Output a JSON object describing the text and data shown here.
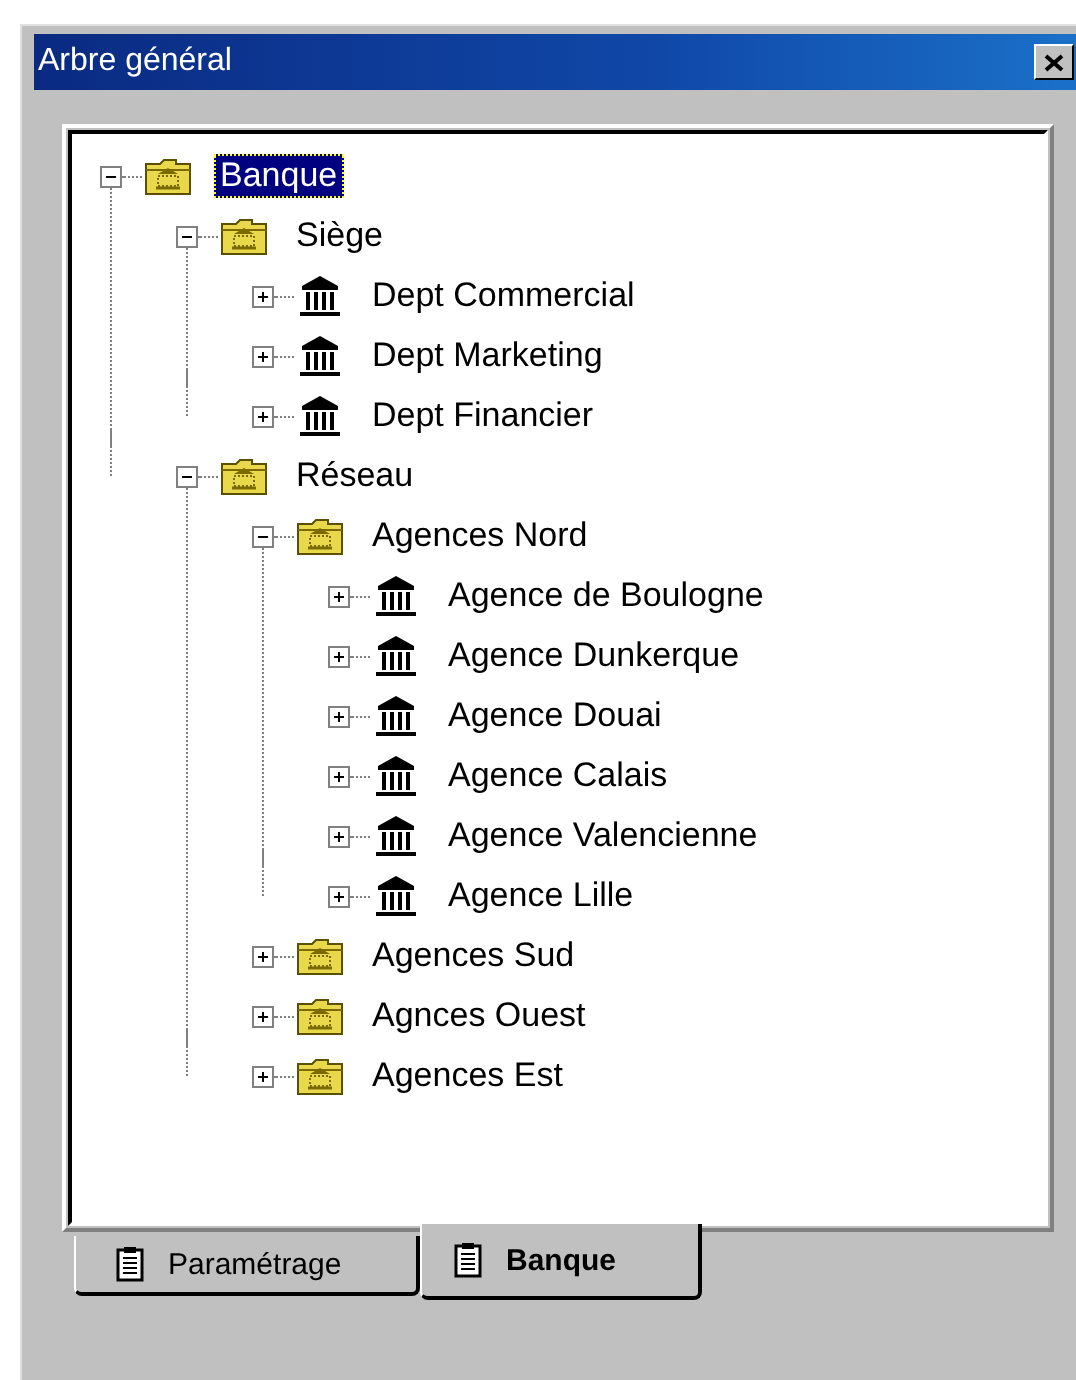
{
  "window": {
    "title": "Arbre général"
  },
  "tree": [
    {
      "label": "Banque",
      "kind": "folder",
      "expanded": true,
      "selected": true,
      "children": [
        {
          "label": "Siège",
          "kind": "folder",
          "expanded": true,
          "selected": false,
          "children": [
            {
              "label": "Dept Commercial",
              "kind": "bank",
              "expanded": false,
              "selected": false
            },
            {
              "label": "Dept Marketing",
              "kind": "bank",
              "expanded": false,
              "selected": false
            },
            {
              "label": "Dept Financier",
              "kind": "bank",
              "expanded": false,
              "selected": false
            }
          ]
        },
        {
          "label": "Réseau",
          "kind": "folder",
          "expanded": true,
          "selected": false,
          "children": [
            {
              "label": "Agences Nord",
              "kind": "folder",
              "expanded": true,
              "selected": false,
              "children": [
                {
                  "label": "Agence de Boulogne",
                  "kind": "bank",
                  "expanded": false,
                  "selected": false
                },
                {
                  "label": "Agence Dunkerque",
                  "kind": "bank",
                  "expanded": false,
                  "selected": false
                },
                {
                  "label": "Agence Douai",
                  "kind": "bank",
                  "expanded": false,
                  "selected": false
                },
                {
                  "label": "Agence Calais",
                  "kind": "bank",
                  "expanded": false,
                  "selected": false
                },
                {
                  "label": "Agence Valencienne",
                  "kind": "bank",
                  "expanded": false,
                  "selected": false
                },
                {
                  "label": "Agence Lille",
                  "kind": "bank",
                  "expanded": false,
                  "selected": false
                }
              ]
            },
            {
              "label": "Agences Sud",
              "kind": "folder",
              "expanded": false,
              "selected": false
            },
            {
              "label": "Agnces Ouest",
              "kind": "folder",
              "expanded": false,
              "selected": false
            },
            {
              "label": "Agences Est",
              "kind": "folder",
              "expanded": false,
              "selected": false
            }
          ]
        }
      ]
    }
  ],
  "tabs": [
    {
      "label": "Paramétrage",
      "selected": false
    },
    {
      "label": "Banque",
      "selected": true
    }
  ]
}
